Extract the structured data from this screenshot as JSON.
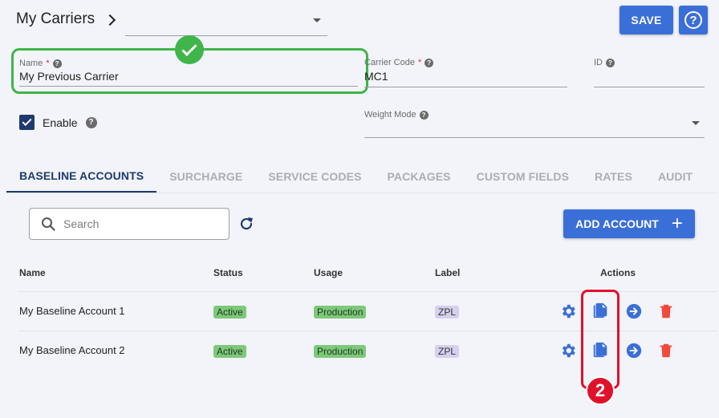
{
  "header": {
    "breadcrumb": "My Carriers",
    "save_label": "SAVE",
    "help_symbol": "?"
  },
  "form": {
    "name": {
      "label": "Name",
      "required": "*",
      "value": "My Previous Carrier"
    },
    "carrier_code": {
      "label": "Carrier Code",
      "required": "*",
      "value": "MC1"
    },
    "id": {
      "label": "ID",
      "value": ""
    },
    "enable": {
      "label": "Enable",
      "checked": true
    },
    "weight_mode": {
      "label": "Weight Mode",
      "value": ""
    }
  },
  "tabs": [
    {
      "label": "BASELINE ACCOUNTS",
      "active": true
    },
    {
      "label": "SURCHARGE",
      "active": false
    },
    {
      "label": "SERVICE CODES",
      "active": false
    },
    {
      "label": "PACKAGES",
      "active": false
    },
    {
      "label": "CUSTOM FIELDS",
      "active": false
    },
    {
      "label": "RATES",
      "active": false
    },
    {
      "label": "AUDIT",
      "active": false
    }
  ],
  "toolbar": {
    "search_placeholder": "Search",
    "add_label": "ADD ACCOUNT"
  },
  "table": {
    "columns": [
      "Name",
      "Status",
      "Usage",
      "Label",
      "Actions"
    ],
    "rows": [
      {
        "name": "My Baseline Account 1",
        "status": "Active",
        "usage": "Production",
        "label": "ZPL"
      },
      {
        "name": "My Baseline Account 2",
        "status": "Active",
        "usage": "Production",
        "label": "ZPL"
      }
    ]
  },
  "annotation": {
    "step": "2"
  },
  "colors": {
    "primary": "#3b6fd8",
    "navy": "#1f3a6e",
    "success": "#3fb54a",
    "danger": "#e0112b",
    "delete": "#f04a3a"
  }
}
